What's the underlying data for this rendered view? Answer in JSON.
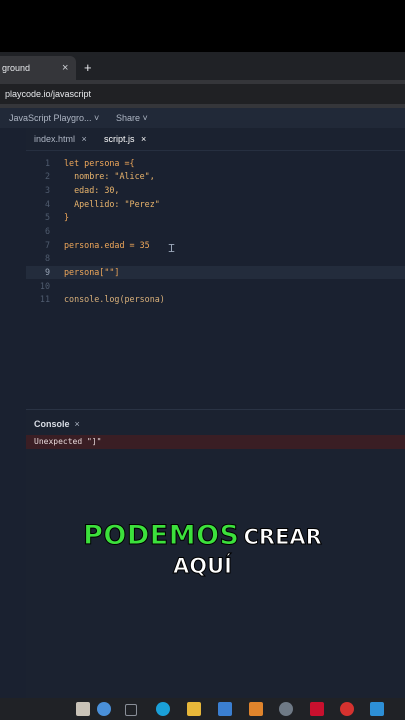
{
  "browser": {
    "tab_title": "ground",
    "tab_close": "×",
    "new_tab": "+",
    "url": "playcode.io/javascript"
  },
  "toolbar": {
    "project": "JavaScript Playgro... ˅",
    "share": "Share ˅"
  },
  "editor_tabs": [
    {
      "label": "index.html",
      "close": "×"
    },
    {
      "label": "script.js",
      "close": "×"
    }
  ],
  "code_lines": [
    {
      "n": "1",
      "text": "let persona ={"
    },
    {
      "n": "2",
      "text": "  nombre: \"Alice\","
    },
    {
      "n": "3",
      "text": "  edad: 30,"
    },
    {
      "n": "4",
      "text": "  Apellido: \"Perez\""
    },
    {
      "n": "5",
      "text": "}"
    },
    {
      "n": "6",
      "text": ""
    },
    {
      "n": "7",
      "text": "persona.edad = 35"
    },
    {
      "n": "8",
      "text": ""
    },
    {
      "n": "9",
      "text": "persona[\"\"]"
    },
    {
      "n": "10",
      "text": ""
    },
    {
      "n": "11",
      "text": "console.log(persona)"
    }
  ],
  "console": {
    "title": "Console",
    "close": "×",
    "error": "Unexpected \"]\""
  },
  "caption": {
    "highlight": "PODEMOS",
    "rest": "CREAR",
    "line2": "AQUÍ"
  },
  "colors": {
    "caption_highlight": "#3ce03c",
    "error_bg": "#3a1e24",
    "editor_bg": "#1b2230"
  }
}
